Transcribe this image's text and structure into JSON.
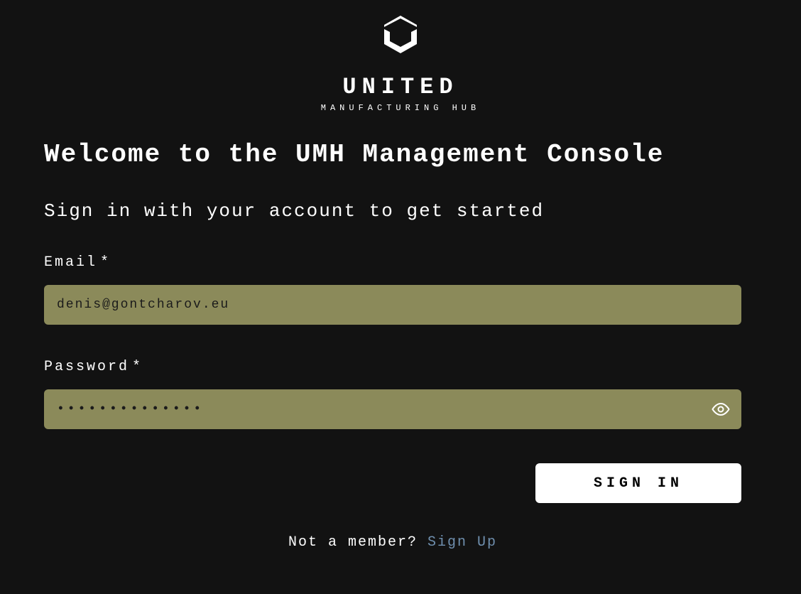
{
  "logo": {
    "brand_top": "UNITED",
    "brand_sub": "MANUFACTURING HUB"
  },
  "heading": "Welcome to the UMH Management Console",
  "subheading": "Sign in with your account to get started",
  "form": {
    "email": {
      "label": "Email",
      "required_mark": "*",
      "value": "denis@gontcharov.eu"
    },
    "password": {
      "label": "Password",
      "required_mark": "*",
      "value": "••••••••••••••"
    },
    "submit_label": "SIGN IN"
  },
  "footer": {
    "prompt": "Not a member? ",
    "link": "Sign Up"
  },
  "colors": {
    "background": "#121212",
    "input_bg": "#8b8a5a",
    "button_bg": "#ffffff",
    "link": "#6f8fae"
  }
}
